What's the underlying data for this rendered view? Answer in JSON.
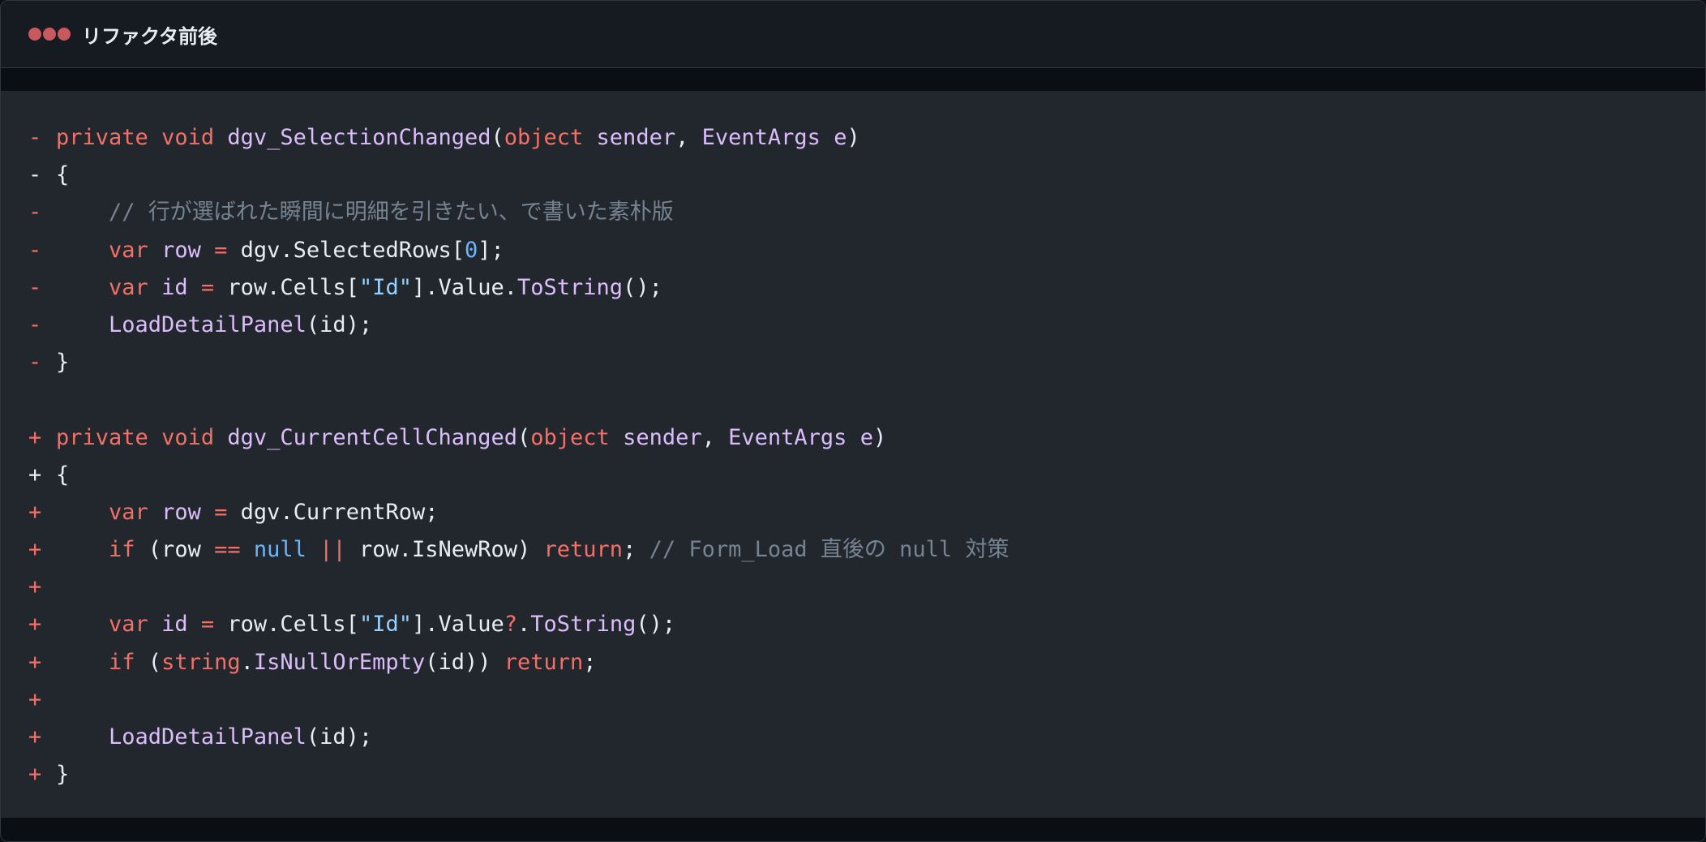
{
  "window": {
    "title": "リファクタ前後"
  },
  "colors": {
    "background": "#0d1117",
    "titlebar": "#161b22",
    "code_bg": "#22272e",
    "keyword": "#f47067",
    "function": "#dcbdfb",
    "comment": "#768390",
    "number": "#6cb6ff",
    "string": "#96d0ff",
    "dot": "#c9585f"
  },
  "code": {
    "lines": [
      {
        "mark": "-",
        "tokens": [
          [
            "kw",
            "private"
          ],
          [
            "pl",
            " "
          ],
          [
            "kw",
            "void"
          ],
          [
            "pl",
            " "
          ],
          [
            "fn",
            "dgv_SelectionChanged"
          ],
          [
            "pl",
            "("
          ],
          [
            "kw",
            "object"
          ],
          [
            "pl",
            " "
          ],
          [
            "ty",
            "sender"
          ],
          [
            "pl",
            ", "
          ],
          [
            "ty",
            "EventArgs"
          ],
          [
            "pl",
            " "
          ],
          [
            "ty",
            "e"
          ],
          [
            "pl",
            ")"
          ]
        ]
      },
      {
        "mark": "-",
        "tokens": [
          [
            "pl",
            "{"
          ]
        ]
      },
      {
        "mark": "-",
        "tokens": [
          [
            "pl",
            "    "
          ],
          [
            "cm",
            "// 行が選ばれた瞬間に明細を引きたい、で書いた素朴版"
          ]
        ]
      },
      {
        "mark": "-",
        "tokens": [
          [
            "pl",
            "    "
          ],
          [
            "kw",
            "var"
          ],
          [
            "pl",
            " "
          ],
          [
            "ty",
            "row"
          ],
          [
            "pl",
            " "
          ],
          [
            "kw",
            "="
          ],
          [
            "pl",
            " dgv.SelectedRows["
          ],
          [
            "num",
            "0"
          ],
          [
            "pl",
            "];"
          ]
        ]
      },
      {
        "mark": "-",
        "tokens": [
          [
            "pl",
            "    "
          ],
          [
            "kw",
            "var"
          ],
          [
            "pl",
            " "
          ],
          [
            "ty",
            "id"
          ],
          [
            "pl",
            " "
          ],
          [
            "kw",
            "="
          ],
          [
            "pl",
            " row.Cells["
          ],
          [
            "str",
            "\"Id\""
          ],
          [
            "pl",
            "].Value."
          ],
          [
            "fn",
            "ToString"
          ],
          [
            "pl",
            "();"
          ]
        ]
      },
      {
        "mark": "-",
        "tokens": [
          [
            "pl",
            "    "
          ],
          [
            "fn",
            "LoadDetailPanel"
          ],
          [
            "pl",
            "(id);"
          ]
        ]
      },
      {
        "mark": "-",
        "tokens": [
          [
            "pl",
            "}"
          ]
        ]
      },
      {
        "mark": "",
        "tokens": []
      },
      {
        "mark": "+",
        "tokens": [
          [
            "kw",
            "private"
          ],
          [
            "pl",
            " "
          ],
          [
            "kw",
            "void"
          ],
          [
            "pl",
            " "
          ],
          [
            "fn",
            "dgv_CurrentCellChanged"
          ],
          [
            "pl",
            "("
          ],
          [
            "kw",
            "object"
          ],
          [
            "pl",
            " "
          ],
          [
            "ty",
            "sender"
          ],
          [
            "pl",
            ", "
          ],
          [
            "ty",
            "EventArgs"
          ],
          [
            "pl",
            " "
          ],
          [
            "ty",
            "e"
          ],
          [
            "pl",
            ")"
          ]
        ]
      },
      {
        "mark": "+",
        "tokens": [
          [
            "pl",
            "{"
          ]
        ]
      },
      {
        "mark": "+",
        "tokens": [
          [
            "pl",
            "    "
          ],
          [
            "kw",
            "var"
          ],
          [
            "pl",
            " "
          ],
          [
            "ty",
            "row"
          ],
          [
            "pl",
            " "
          ],
          [
            "kw",
            "="
          ],
          [
            "pl",
            " dgv.CurrentRow;"
          ]
        ]
      },
      {
        "mark": "+",
        "tokens": [
          [
            "pl",
            "    "
          ],
          [
            "kw",
            "if"
          ],
          [
            "pl",
            " (row "
          ],
          [
            "kw",
            "=="
          ],
          [
            "pl",
            " "
          ],
          [
            "nul",
            "null"
          ],
          [
            "pl",
            " "
          ],
          [
            "kw",
            "||"
          ],
          [
            "pl",
            " row.IsNewRow) "
          ],
          [
            "kw",
            "return"
          ],
          [
            "pl",
            "; "
          ],
          [
            "cm",
            "// Form_Load 直後の null 対策"
          ]
        ]
      },
      {
        "mark": "+",
        "tokens": []
      },
      {
        "mark": "+",
        "tokens": [
          [
            "pl",
            "    "
          ],
          [
            "kw",
            "var"
          ],
          [
            "pl",
            " "
          ],
          [
            "ty",
            "id"
          ],
          [
            "pl",
            " "
          ],
          [
            "kw",
            "="
          ],
          [
            "pl",
            " row.Cells["
          ],
          [
            "str",
            "\"Id\""
          ],
          [
            "pl",
            "].Value"
          ],
          [
            "kw",
            "?"
          ],
          [
            "pl",
            "."
          ],
          [
            "fn",
            "ToString"
          ],
          [
            "pl",
            "();"
          ]
        ]
      },
      {
        "mark": "+",
        "tokens": [
          [
            "pl",
            "    "
          ],
          [
            "kw",
            "if"
          ],
          [
            "pl",
            " ("
          ],
          [
            "kw",
            "string"
          ],
          [
            "pl",
            "."
          ],
          [
            "fn",
            "IsNullOrEmpty"
          ],
          [
            "pl",
            "(id)) "
          ],
          [
            "kw",
            "return"
          ],
          [
            "pl",
            ";"
          ]
        ]
      },
      {
        "mark": "+",
        "tokens": []
      },
      {
        "mark": "+",
        "tokens": [
          [
            "pl",
            "    "
          ],
          [
            "fn",
            "LoadDetailPanel"
          ],
          [
            "pl",
            "(id);"
          ]
        ]
      },
      {
        "mark": "+",
        "tokens": [
          [
            "pl",
            "}"
          ]
        ]
      }
    ]
  }
}
